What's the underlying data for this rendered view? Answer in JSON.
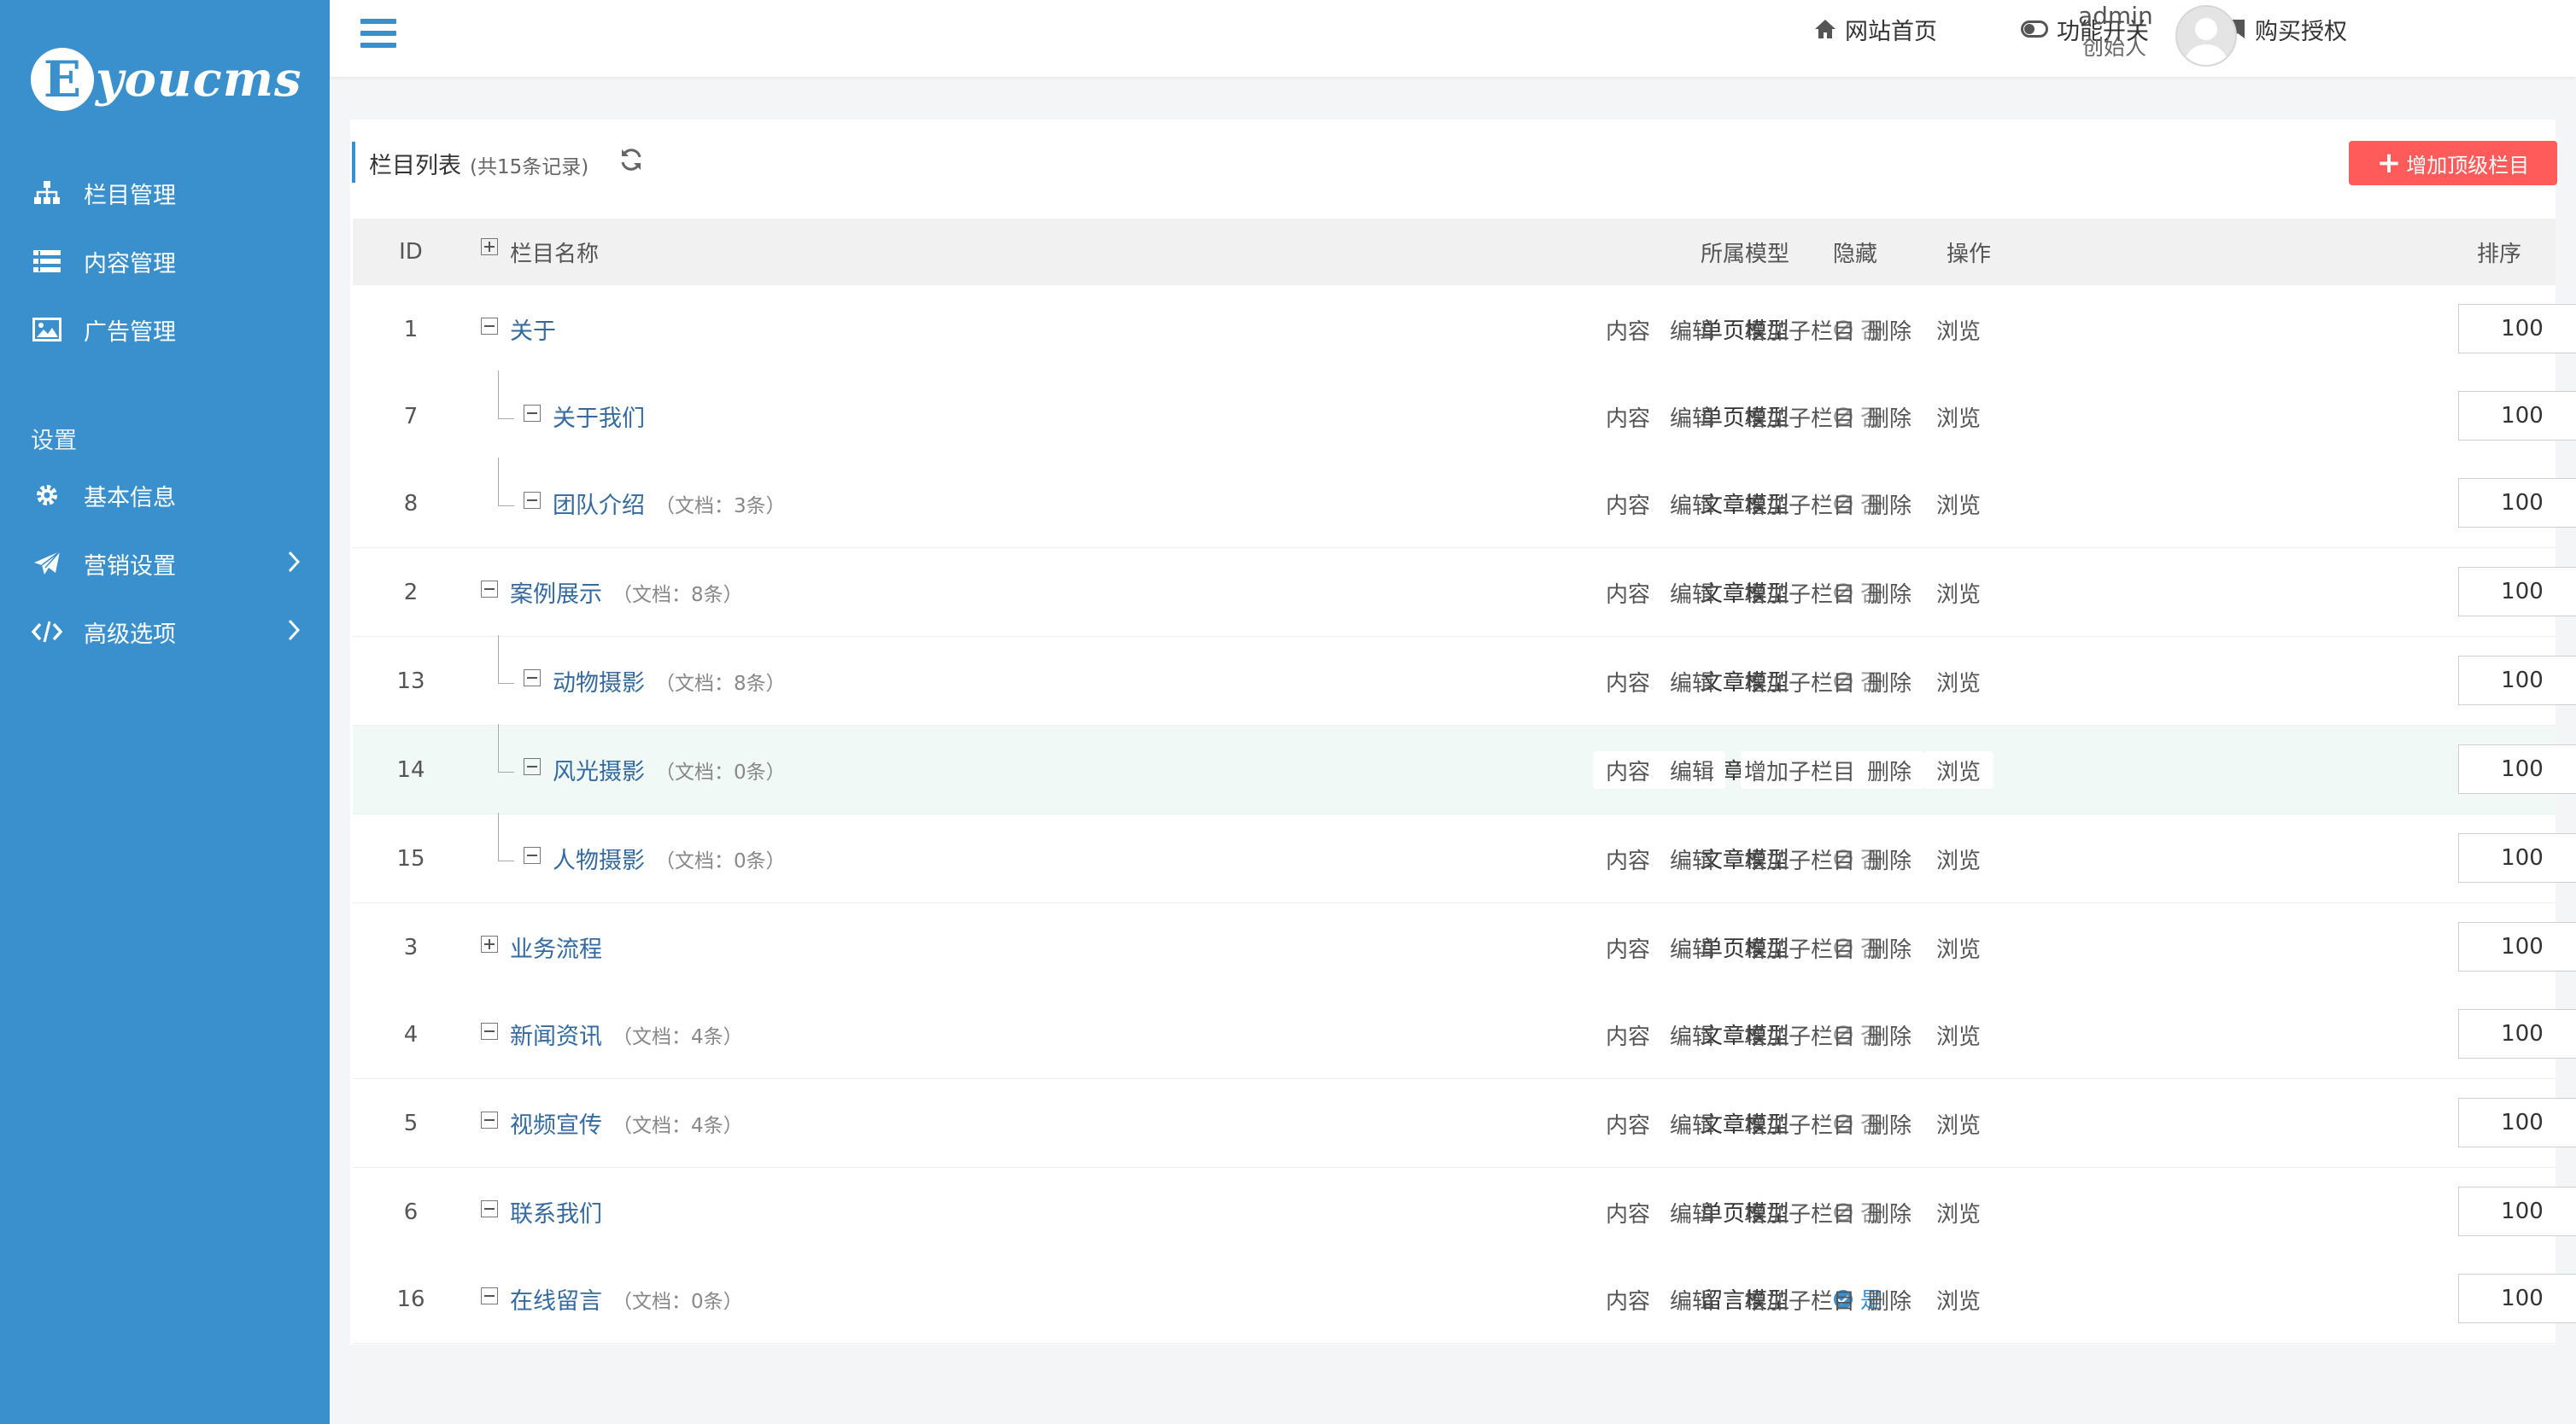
{
  "brand": {
    "logo_letter": "E",
    "logo_text": "youcms"
  },
  "sidebar": {
    "items": [
      {
        "label": "栏目管理",
        "icon": "sitemap-icon"
      },
      {
        "label": "内容管理",
        "icon": "list-icon"
      },
      {
        "label": "广告管理",
        "icon": "image-icon"
      }
    ],
    "settings_heading": "设置",
    "settings_items": [
      {
        "label": "基本信息",
        "icon": "gear-icon"
      },
      {
        "label": "营销设置",
        "icon": "paper-plane-icon"
      },
      {
        "label": "高级选项",
        "icon": "code-icon"
      }
    ]
  },
  "topbar": {
    "home": "网站首页",
    "features": "功能开关",
    "buy": "购买授权",
    "user_name": "admin",
    "user_role": "创始人"
  },
  "list": {
    "title": "栏目列表",
    "count": "(共15条记录)",
    "add_button": "增加顶级栏目"
  },
  "table": {
    "headers": {
      "id": "ID",
      "name": "栏目名称",
      "model": "所属模型",
      "hidden": "隐藏",
      "actions": "操作",
      "sort": "排序"
    },
    "action_labels": [
      "内容",
      "编辑",
      "增加子栏目",
      "删除",
      "浏览"
    ],
    "rows": [
      {
        "id": "1",
        "name": "关于",
        "docs": "",
        "level": 0,
        "toggle": "minus",
        "model": "单页模型",
        "hidden": "否",
        "hidden_state": false,
        "sort": "100"
      },
      {
        "id": "7",
        "name": "关于我们",
        "docs": "",
        "level": 1,
        "toggle": "minus",
        "model": "单页模型",
        "hidden": "否",
        "hidden_state": false,
        "sort": "100"
      },
      {
        "id": "8",
        "name": "团队介绍",
        "docs": "（文档：3条）",
        "level": 1,
        "toggle": "minus",
        "model": "文章模型",
        "hidden": "否",
        "hidden_state": false,
        "sort": "100"
      },
      {
        "id": "2",
        "name": "案例展示",
        "docs": "（文档：8条）",
        "level": 0,
        "toggle": "minus",
        "model": "文章模型",
        "hidden": "否",
        "hidden_state": false,
        "sort": "100"
      },
      {
        "id": "13",
        "name": "动物摄影",
        "docs": "（文档：8条）",
        "level": 1,
        "toggle": "minus",
        "model": "文章模型",
        "hidden": "否",
        "hidden_state": false,
        "sort": "100"
      },
      {
        "id": "14",
        "name": "风光摄影",
        "docs": "（文档：0条）",
        "level": 1,
        "toggle": "minus",
        "model": "文章模型",
        "hidden": "否",
        "hidden_state": false,
        "sort": "100",
        "highlight": true
      },
      {
        "id": "15",
        "name": "人物摄影",
        "docs": "（文档：0条）",
        "level": 1,
        "toggle": "minus",
        "model": "文章模型",
        "hidden": "否",
        "hidden_state": false,
        "sort": "100"
      },
      {
        "id": "3",
        "name": "业务流程",
        "docs": "",
        "level": 0,
        "toggle": "plus",
        "model": "单页模型",
        "hidden": "否",
        "hidden_state": false,
        "sort": "100"
      },
      {
        "id": "4",
        "name": "新闻资讯",
        "docs": "（文档：4条）",
        "level": 0,
        "toggle": "minus",
        "model": "文章模型",
        "hidden": "否",
        "hidden_state": false,
        "sort": "100"
      },
      {
        "id": "5",
        "name": "视频宣传",
        "docs": "（文档：4条）",
        "level": 0,
        "toggle": "minus",
        "model": "文章模型",
        "hidden": "否",
        "hidden_state": false,
        "sort": "100"
      },
      {
        "id": "6",
        "name": "联系我们",
        "docs": "",
        "level": 0,
        "toggle": "minus",
        "model": "单页模型",
        "hidden": "否",
        "hidden_state": false,
        "sort": "100"
      },
      {
        "id": "16",
        "name": "在线留言",
        "docs": "（文档：0条）",
        "level": 0,
        "toggle": "minus",
        "model": "留言模型",
        "hidden": "是",
        "hidden_state": true,
        "sort": "100"
      }
    ]
  },
  "colors": {
    "sidebar": "#3a8fcd",
    "accent": "#3a8fcd",
    "danger": "#ff5b5b",
    "link": "#356aa0"
  }
}
